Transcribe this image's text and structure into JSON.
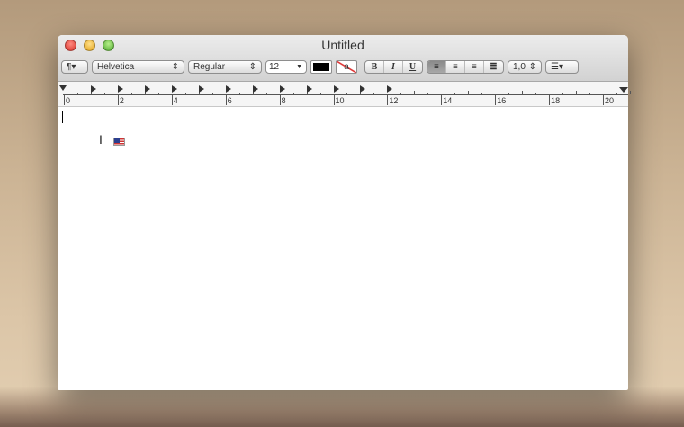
{
  "window": {
    "title": "Untitled"
  },
  "toolbar": {
    "paragraph_menu": "¶▾",
    "font_family": "Helvetica",
    "font_style": "Regular",
    "font_size": "12",
    "text_color": "#000000",
    "background_color_label": "a",
    "bold": "B",
    "italic": "I",
    "underline": "U",
    "alignment": [
      "left",
      "center",
      "right",
      "justify"
    ],
    "active_alignment": "left",
    "line_spacing": "1,0",
    "list_menu": "☰▾"
  },
  "ruler": {
    "labels": [
      "0",
      "2",
      "4",
      "6",
      "8",
      "10",
      "12",
      "14",
      "16",
      "18",
      "20"
    ],
    "tab_stops_cm": [
      1,
      2,
      3,
      4,
      5,
      6,
      7,
      8,
      9,
      10,
      11,
      12
    ]
  },
  "document": {
    "text": ""
  }
}
